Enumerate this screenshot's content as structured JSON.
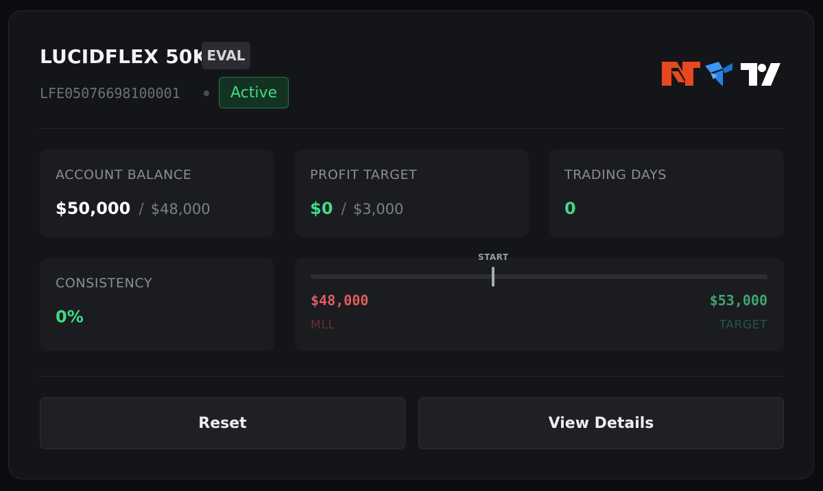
{
  "account": {
    "name": "LUCIDFLEX 50K",
    "type_badge": "EVAL",
    "id": "LFE05076698100001",
    "status": "Active"
  },
  "platforms": [
    {
      "name": "NinjaTrader",
      "icon": "ninjatrader-logo",
      "color": "#e8481e"
    },
    {
      "name": "Tradovate",
      "icon": "tradovate-logo",
      "color": "#2a8bf0"
    },
    {
      "name": "TradingView",
      "icon": "tradingview-logo",
      "color": "#ffffff"
    }
  ],
  "stats": {
    "balance": {
      "label": "ACCOUNT BALANCE",
      "value": "$50,000",
      "sub": "$48,000"
    },
    "profit_target": {
      "label": "PROFIT TARGET",
      "value": "$0",
      "sub": "$3,000"
    },
    "trading_days": {
      "label": "TRADING DAYS",
      "value": "0"
    },
    "consistency": {
      "label": "CONSISTENCY",
      "value": "0%"
    }
  },
  "progress": {
    "start_label": "START",
    "start_position_fraction": 0.4,
    "mll_value": "$48,000",
    "mll_label": "MLL",
    "target_value": "$53,000",
    "target_label": "TARGET"
  },
  "actions": {
    "reset_label": "Reset",
    "view_details_label": "View Details"
  },
  "colors": {
    "positive": "#3ddc84",
    "negative": "#e05d5d",
    "background": "#141518"
  }
}
